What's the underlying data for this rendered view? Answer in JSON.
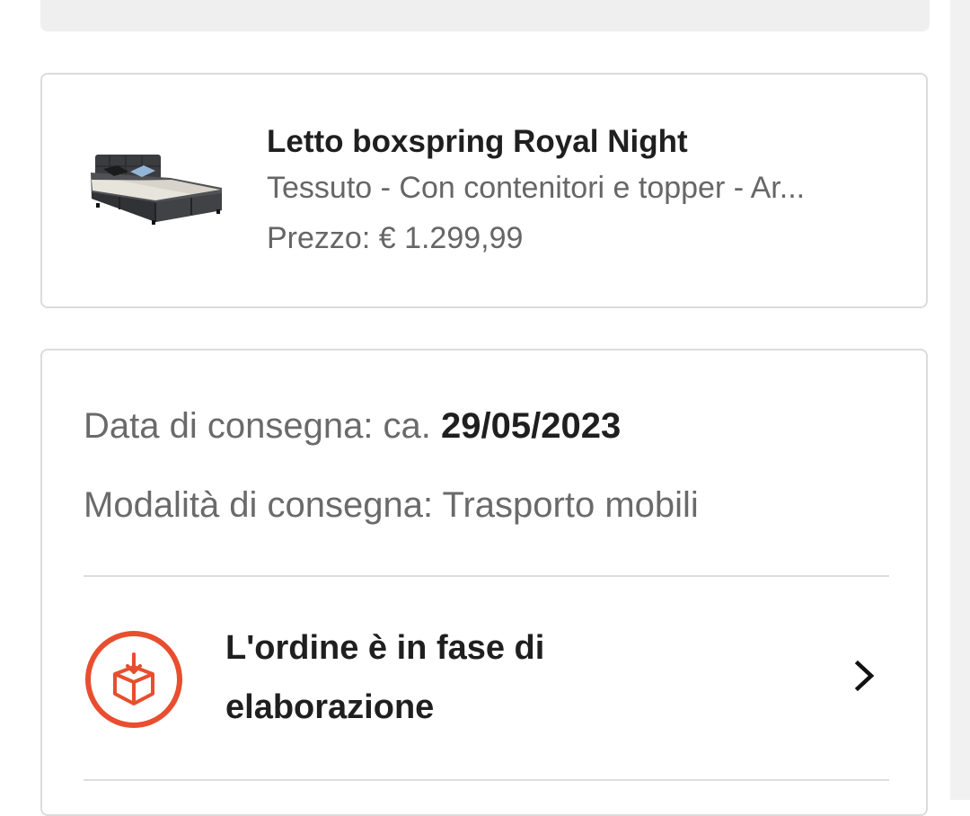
{
  "product": {
    "name": "Letto boxspring Royal Night",
    "description": "Tessuto - Con contenitori e topper - Ar...",
    "price": "Prezzo: € 1.299,99"
  },
  "delivery": {
    "date_label": "Data di consegna: ca.",
    "date_value": "29/05/2023",
    "mode": "Modalità di consegna: Trasporto mobili"
  },
  "order_status": {
    "text": "L'ordine è in fase di elaborazione",
    "icon": "package-download-icon",
    "accent_color": "#e84e2f"
  }
}
